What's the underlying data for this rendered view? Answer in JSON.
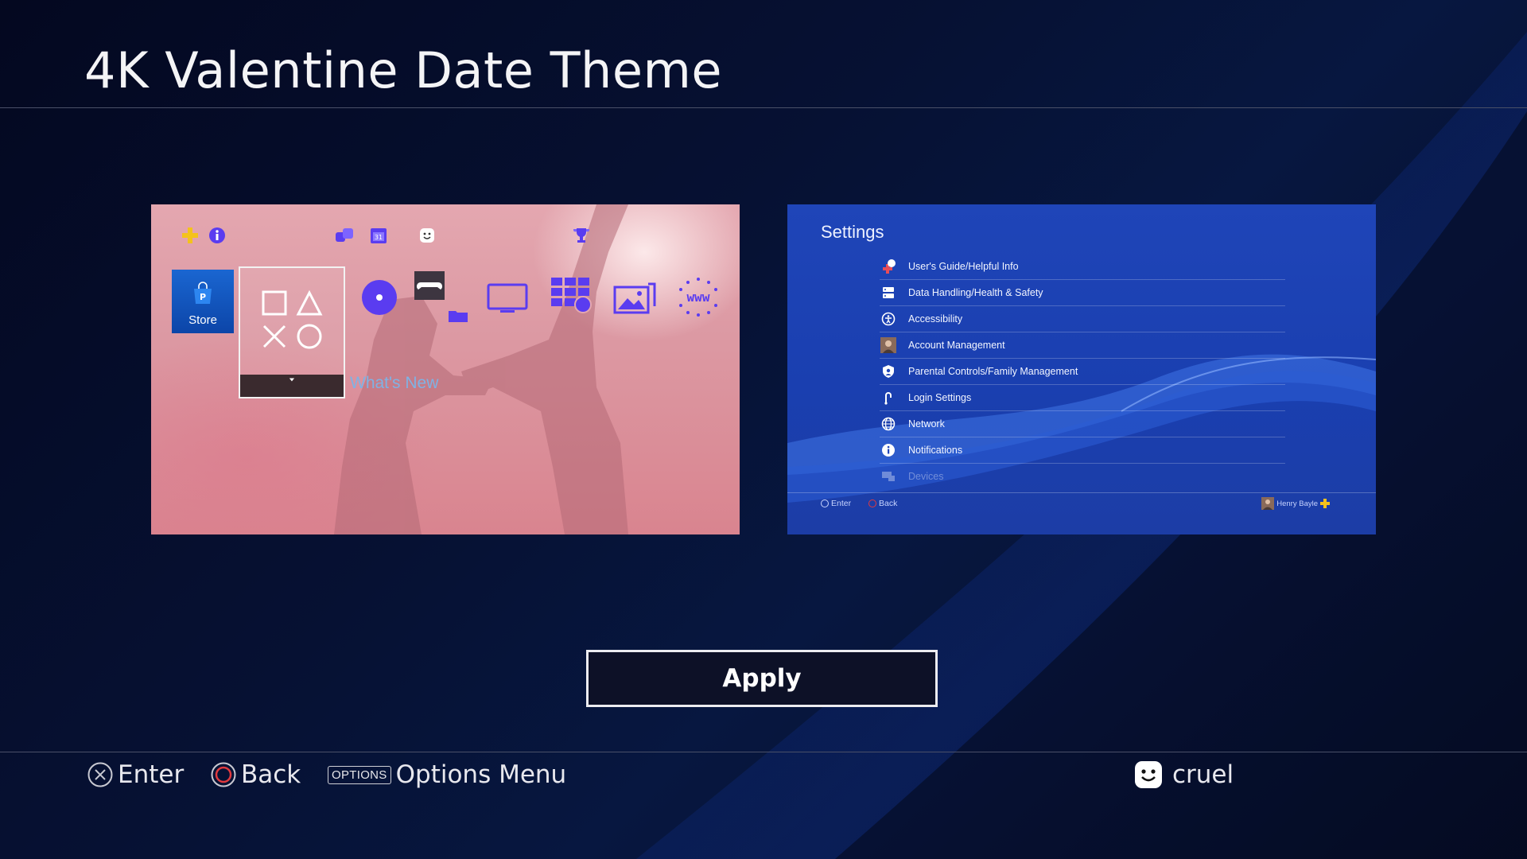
{
  "header": {
    "title": "4K Valentine Date Theme"
  },
  "preview_home": {
    "store_label": "Store",
    "whats_new_label": "What's New"
  },
  "preview_settings": {
    "title": "Settings",
    "items": [
      {
        "label": "User's Guide/Helpful Info",
        "icon": "help-icon"
      },
      {
        "label": "Data Handling/Health & Safety",
        "icon": "data-handling-icon"
      },
      {
        "label": "Accessibility",
        "icon": "accessibility-icon"
      },
      {
        "label": "Account Management",
        "icon": "account-avatar-icon"
      },
      {
        "label": "Parental Controls/Family Management",
        "icon": "parental-controls-icon"
      },
      {
        "label": "Login Settings",
        "icon": "login-icon"
      },
      {
        "label": "Network",
        "icon": "globe-icon"
      },
      {
        "label": "Notifications",
        "icon": "info-icon"
      },
      {
        "label": "Devices",
        "icon": "devices-icon"
      }
    ],
    "footer": {
      "enter": "Enter",
      "back": "Back",
      "user": "Henry Bayle"
    }
  },
  "apply_label": "Apply",
  "hints": {
    "enter": "Enter",
    "back": "Back",
    "options_chip": "OPTIONS",
    "options": "Options Menu"
  },
  "user": {
    "name": "cruel"
  },
  "colors": {
    "background": "#050a1f",
    "accent_blue": "#1a3fb0",
    "circle_button": "#e0393e",
    "plus_gold": "#f4c21b",
    "icon_purple": "#5a3cf0"
  }
}
